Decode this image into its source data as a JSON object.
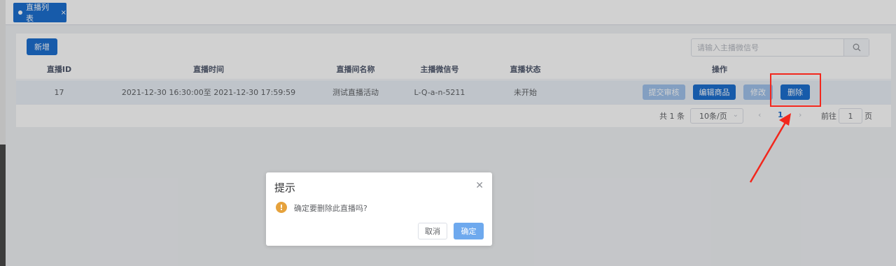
{
  "tabs": [
    {
      "label": "直播列表",
      "close": "×"
    }
  ],
  "toolbar": {
    "add_label": "新增",
    "search_placeholder": "请输入主播微信号"
  },
  "table": {
    "headers": [
      "直播ID",
      "直播时间",
      "直播间名称",
      "主播微信号",
      "直播状态",
      "操作"
    ],
    "rows": [
      {
        "id": "17",
        "time": "2021-12-30 16:30:00至 2021-12-30 17:59:59",
        "name": "测试直播活动",
        "wechat": "L-Q-a-n-5211",
        "status": "未开始",
        "actions": [
          "提交审核",
          "编辑商品",
          "修改",
          "删除"
        ]
      }
    ]
  },
  "pagination": {
    "total": "共 1 条",
    "page_size": "10条/页",
    "current_page": "1",
    "goto_label": "前往",
    "goto_value": "1",
    "page_unit": "页"
  },
  "dialog": {
    "title": "提示",
    "message": "确定要删除此直播吗?",
    "cancel_label": "取消",
    "confirm_label": "确定"
  },
  "colors": {
    "primary": "#1d6fd0",
    "disabled": "#a0c3ec",
    "annotation": "#f2271d",
    "warning": "#e6a23c"
  }
}
